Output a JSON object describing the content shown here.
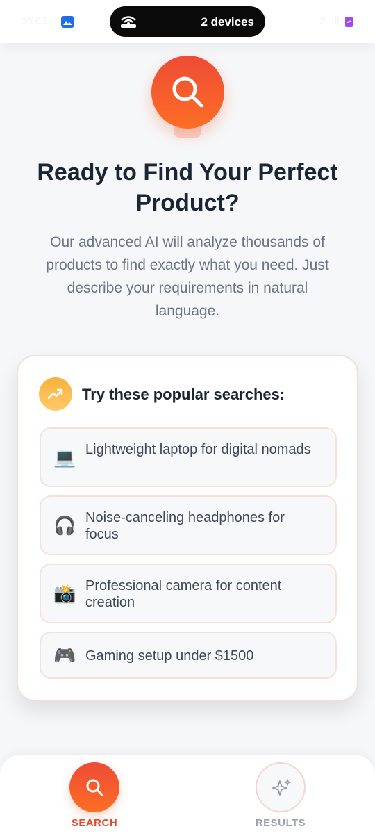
{
  "status_bar": {
    "time": "05:03",
    "cast_label": "2 devices",
    "signal_text": "2 .ıll"
  },
  "hero": {
    "icon": "search-icon",
    "title": "Ready to Find Your Perfect Product?",
    "description": "Our advanced AI will analyze thousands of products to find exactly what you need. Just describe your requirements in natural language."
  },
  "popular": {
    "icon": "trending-up-icon",
    "heading": "Try these popular searches:",
    "items": [
      {
        "emoji": "💻",
        "icon": "laptop-icon",
        "label": "Lightweight laptop for digital nomads"
      },
      {
        "emoji": "🎧",
        "icon": "headphones-icon",
        "label": "Noise-canceling headphones for focus"
      },
      {
        "emoji": "📸",
        "icon": "camera-icon",
        "label": "Professional camera for content creation"
      },
      {
        "emoji": "🎮",
        "icon": "gamepad-icon",
        "label": "Gaming setup under $1500"
      }
    ]
  },
  "bottom_nav": {
    "search": {
      "label": "SEARCH",
      "icon": "search-icon",
      "active": true
    },
    "results": {
      "label": "RESULTS",
      "icon": "sparkles-icon",
      "active": false
    }
  },
  "colors": {
    "accent": "#F05A32",
    "accent_gradient_end": "#FD6E24",
    "text_dark": "#1B2533",
    "text_muted": "#6B7483",
    "badge_yellow": "#F6B13A"
  }
}
